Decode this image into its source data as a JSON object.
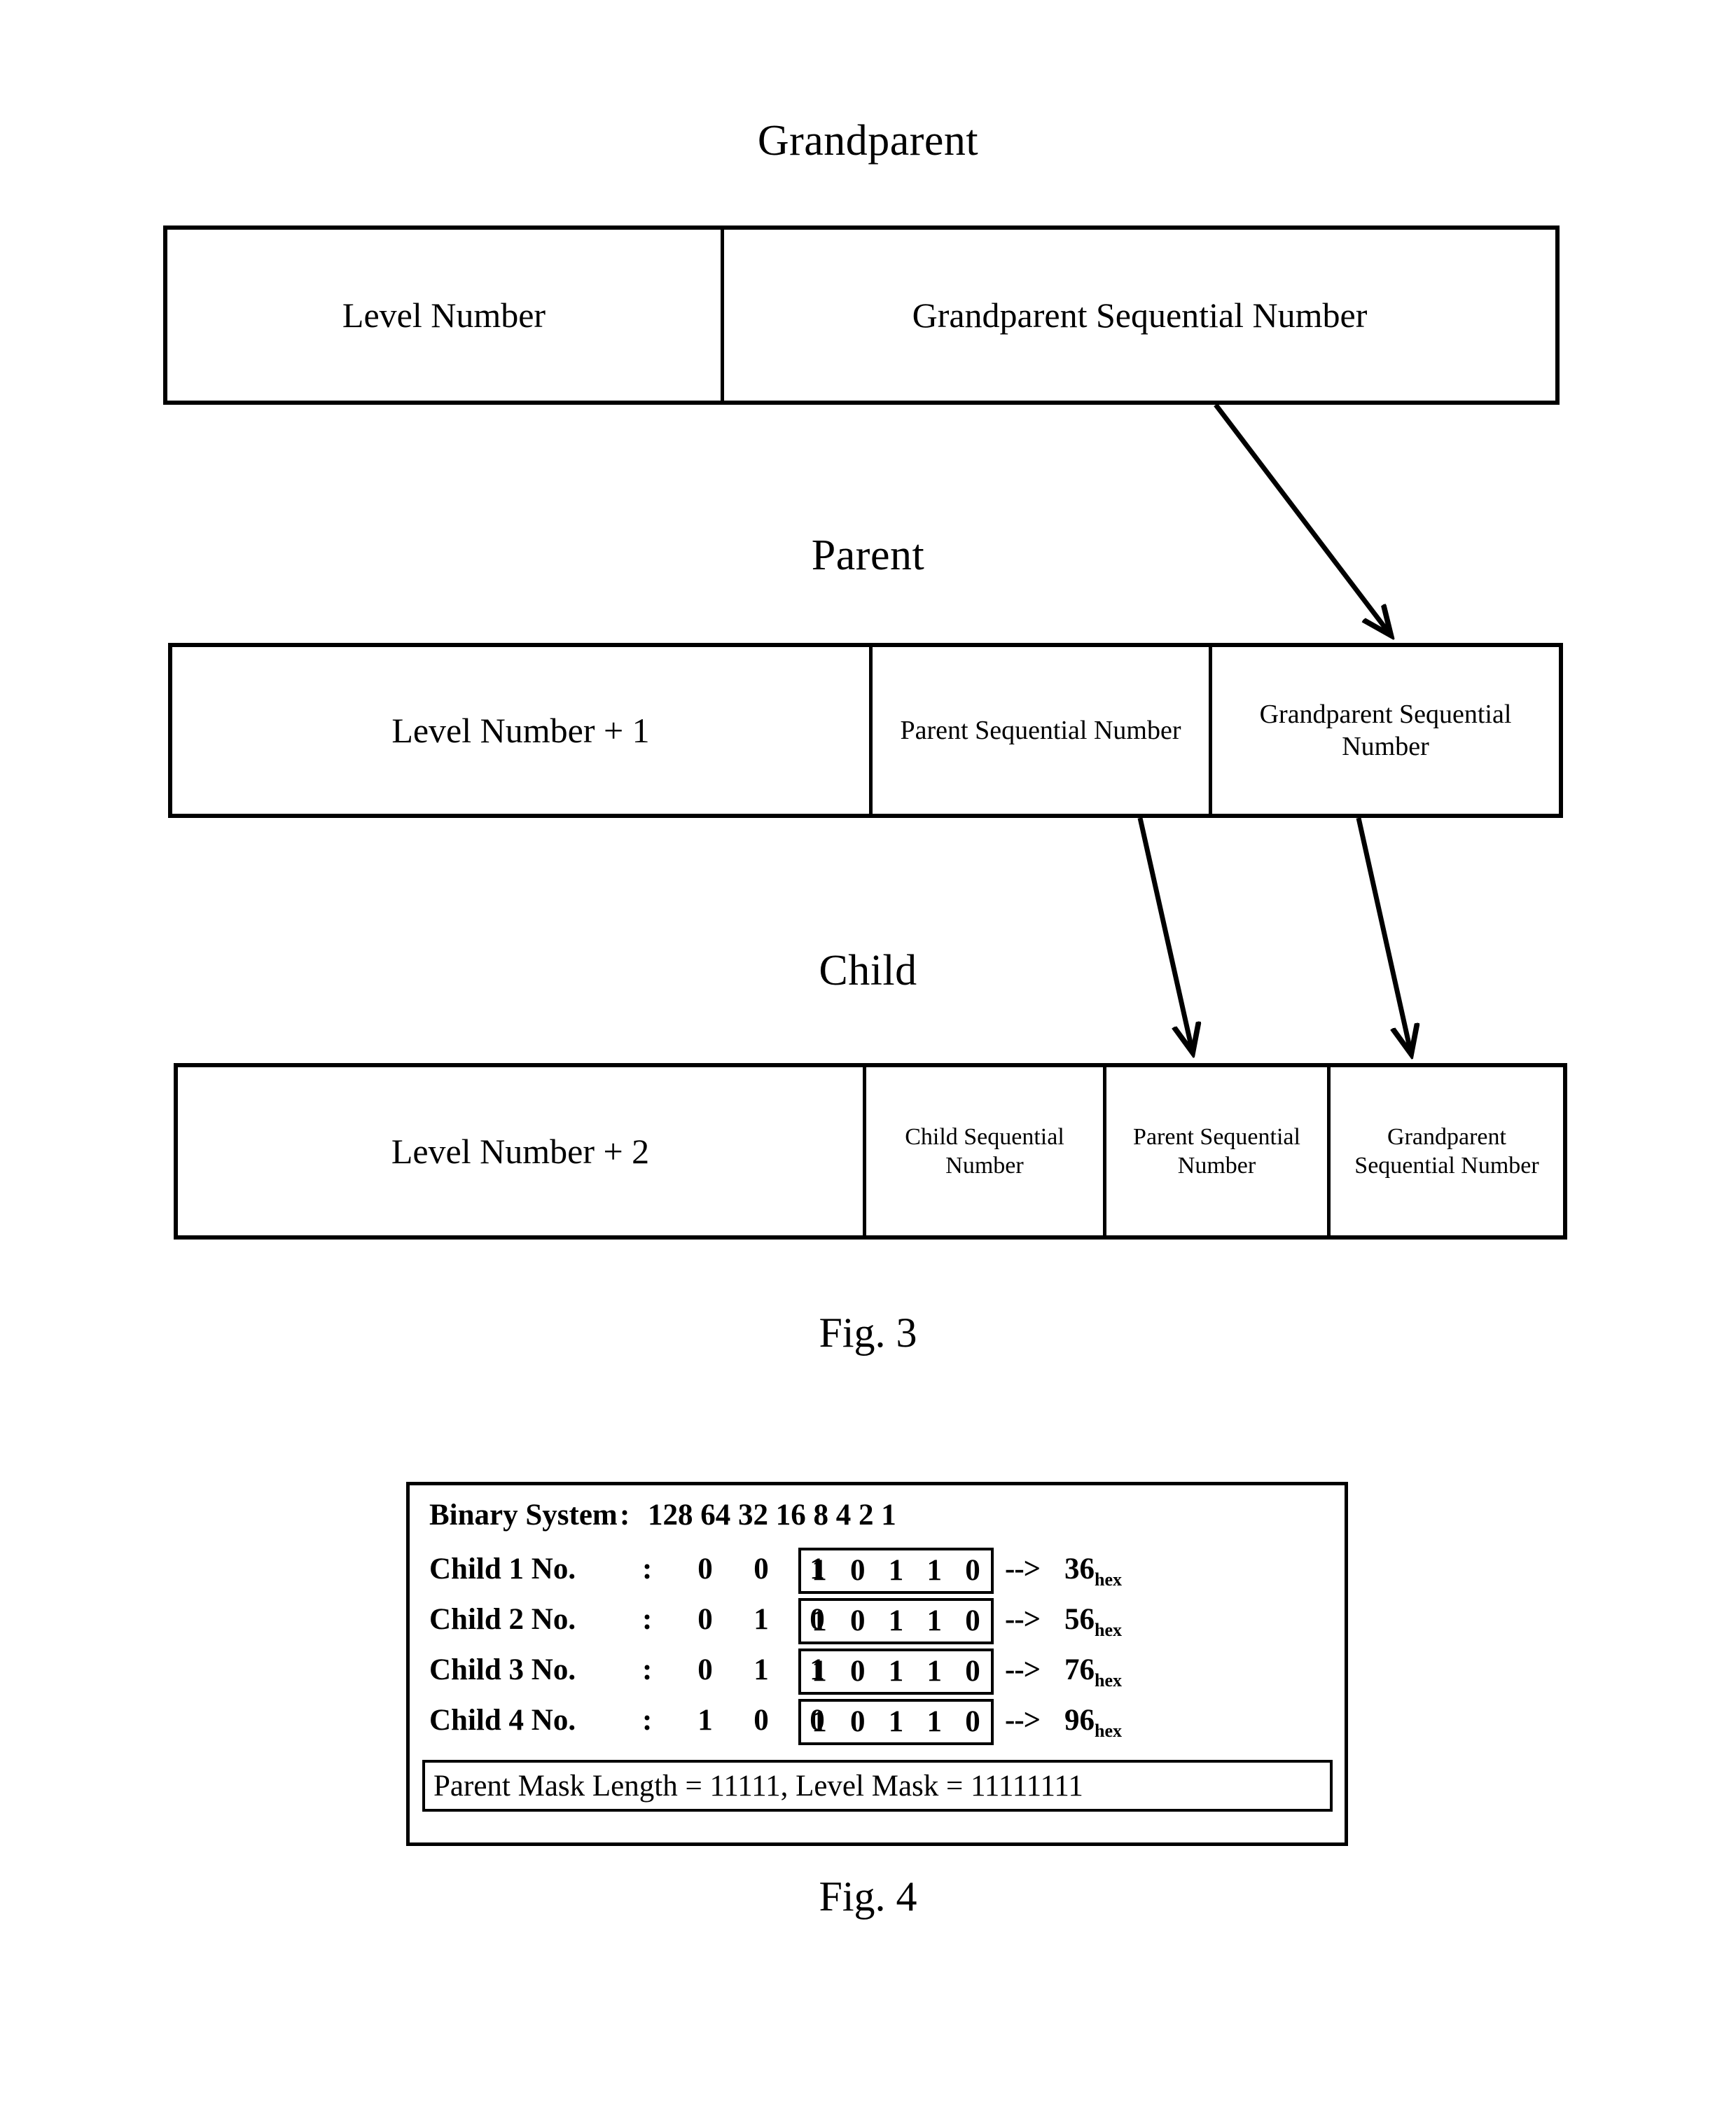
{
  "figure3": {
    "caption": "Fig. 3",
    "levels": [
      {
        "title": "Grandparent",
        "cells": [
          {
            "text": "Level Number"
          },
          {
            "text": "Grandparent Sequential Number"
          }
        ]
      },
      {
        "title": "Parent",
        "cells": [
          {
            "text": "Level Number + 1"
          },
          {
            "text": "Parent Sequential Number"
          },
          {
            "text": "Grandparent Sequential Number"
          }
        ]
      },
      {
        "title": "Child",
        "cells": [
          {
            "text": "Level Number + 2"
          },
          {
            "text": "Child Sequential Number"
          },
          {
            "text": "Parent Sequential Number"
          },
          {
            "text": "Grandparent Sequential Number"
          }
        ]
      }
    ]
  },
  "figure4": {
    "caption": "Fig. 4",
    "header": {
      "label": "Binary System",
      "colon": ":",
      "weights": "128  64  32  16  8  4  2  1"
    },
    "rows": [
      {
        "label": "Child 1 No.",
        "colon": ":",
        "prefix_bits": [
          "0",
          "0",
          "1"
        ],
        "boxed_bits": [
          "1",
          "0",
          "1",
          "1",
          "0"
        ],
        "arrow": "-->",
        "hex_value": "36",
        "hex_suffix": "hex"
      },
      {
        "label": "Child 2 No.",
        "colon": ":",
        "prefix_bits": [
          "0",
          "1",
          "0"
        ],
        "boxed_bits": [
          "1",
          "0",
          "1",
          "1",
          "0"
        ],
        "arrow": "-->",
        "hex_value": "56",
        "hex_suffix": "hex"
      },
      {
        "label": "Child 3 No.",
        "colon": ":",
        "prefix_bits": [
          "0",
          "1",
          "1"
        ],
        "boxed_bits": [
          "1",
          "0",
          "1",
          "1",
          "0"
        ],
        "arrow": "-->",
        "hex_value": "76",
        "hex_suffix": "hex"
      },
      {
        "label": "Child 4 No.",
        "colon": ":",
        "prefix_bits": [
          "1",
          "0",
          "0"
        ],
        "boxed_bits": [
          "1",
          "0",
          "1",
          "1",
          "0"
        ],
        "arrow": "-->",
        "hex_value": "96",
        "hex_suffix": "hex"
      }
    ],
    "mask_note": "Parent Mask Length = 11111, Level Mask = 11111111"
  }
}
